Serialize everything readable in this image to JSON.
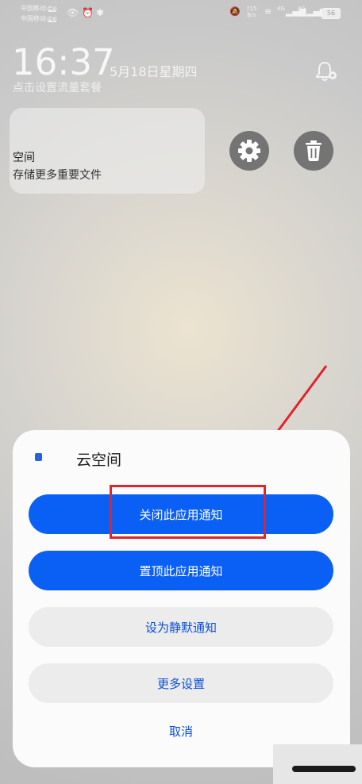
{
  "status_bar": {
    "carrier1": "中国移动",
    "carrier2": "中国移动",
    "hd": "HD",
    "speed_value": "715",
    "speed_unit": "B/s",
    "signal_label": "4G",
    "battery": "56"
  },
  "lockscreen": {
    "time": "16:37",
    "date": "5月18日星期四",
    "data_plan_hint": "点击设置流量套餐"
  },
  "notification": {
    "app_name": "空间",
    "message": "存储更多重要文件"
  },
  "sheet": {
    "app_title": "云空间",
    "actions": [
      {
        "label": "关闭此应用通知"
      },
      {
        "label": "置顶此应用通知"
      },
      {
        "label": "设为静默通知"
      },
      {
        "label": "更多设置"
      }
    ],
    "cancel": "取消"
  },
  "colors": {
    "primary_button": "#0a5ff5",
    "annotation_red": "#e0242c"
  }
}
